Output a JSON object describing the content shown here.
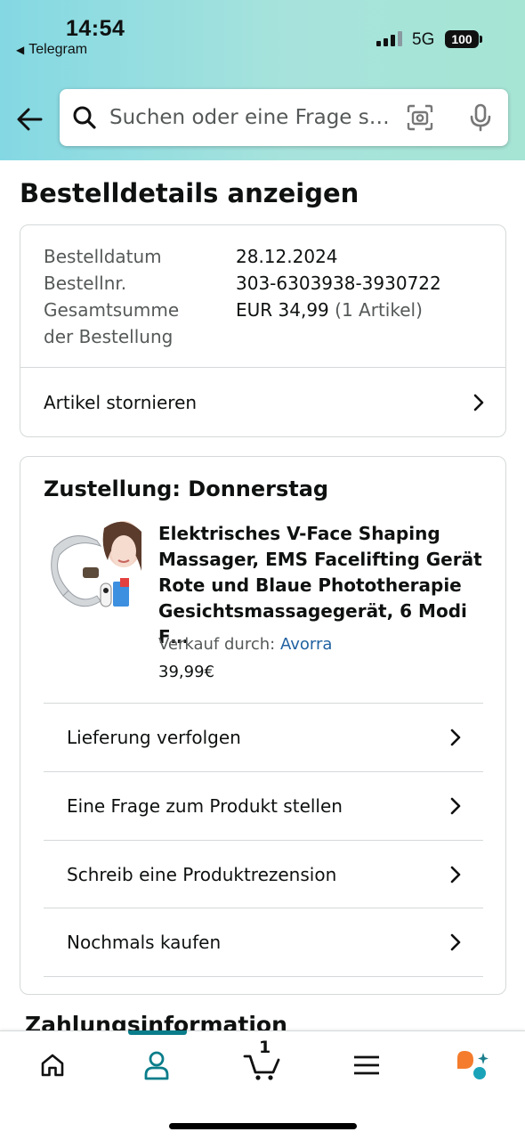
{
  "status_bar": {
    "time": "14:54",
    "back_app": "Telegram",
    "network": "5G",
    "battery": "100"
  },
  "search": {
    "placeholder": "Suchen oder eine Frage s…"
  },
  "page": {
    "title": "Bestelldetails anzeigen"
  },
  "order_summary": {
    "date_label": "Bestelldatum",
    "date_value": "28.12.2024",
    "number_label": "Bestellnr.",
    "number_value": "303-6303938-3930722",
    "total_label_line1": "Gesamtsumme",
    "total_label_line2": "der Bestellung",
    "total_value": "EUR 34,99",
    "total_items": "(1 Artikel)",
    "cancel_label": "Artikel stornieren"
  },
  "delivery": {
    "title": "Zustellung: Donnerstag",
    "product_title": "Elektrisches V-Face Shaping Massager, EMS Facelifting Gerät Rote und Blaue Phototherapie Gesichtsmassagegerät, 6 Modi F…",
    "seller_prefix": "Verkauf durch:",
    "seller_name": "Avorra",
    "price": "39,99€",
    "actions": [
      {
        "label": "Lieferung verfolgen"
      },
      {
        "label": "Eine Frage zum Produkt stellen"
      },
      {
        "label": "Schreib eine Produktrezension"
      },
      {
        "label": "Nochmals kaufen"
      }
    ]
  },
  "payment": {
    "heading": "Zahlungsinformation"
  },
  "bottom_nav": {
    "cart_count": "1",
    "items": [
      "home-icon",
      "account-icon",
      "cart-icon",
      "menu-icon",
      "rufus-icon"
    ],
    "active_color": "#0a7d8a"
  }
}
